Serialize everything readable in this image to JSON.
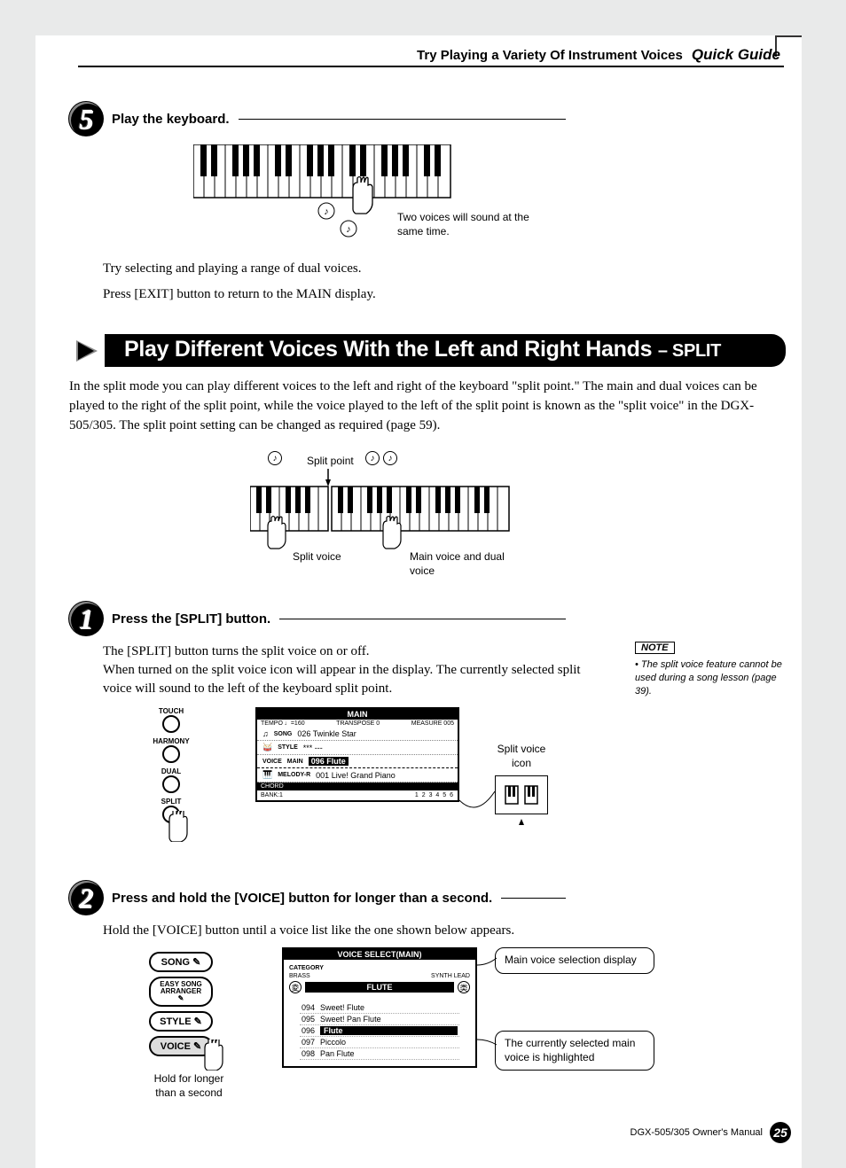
{
  "header": {
    "breadcrumb": "Try Playing a Variety Of Instrument Voices",
    "guide": "Quick Guide"
  },
  "step5": {
    "num": "5",
    "title": "Play the keyboard.",
    "callout": "Two voices will sound at the same time.",
    "body1": "Try selecting and playing a range of dual voices.",
    "body2": "Press [EXIT] button to return to the MAIN display."
  },
  "section": {
    "title_main": "Play Different Voices With the Left and Right Hands",
    "title_sub": "– SPLIT",
    "intro": "In the split mode you can play different voices to the left and right of the keyboard \"split point.\" The main and dual voices can be played to the right of the split point, while the voice played to the left of the split point is known as the \"split voice\" in the DGX-505/305. The split point setting can be changed as required (page 59)."
  },
  "split_diagram": {
    "split_point": "Split point",
    "split_voice": "Split voice",
    "main_voice": "Main voice and dual voice"
  },
  "step1": {
    "num": "1",
    "title": "Press the [SPLIT] button.",
    "body": "The [SPLIT] button turns the split voice on or off.\nWhen turned on the split voice icon will appear in the display. The currently selected split voice will sound to the left of the keyboard split point.",
    "note_label": "NOTE",
    "note_text": "• The split voice feature cannot be used during a song lesson (page 39).",
    "buttons": {
      "touch": "TOUCH",
      "harmony": "HARMONY",
      "dual": "DUAL",
      "split": "SPLIT"
    },
    "callout_icon": "Split voice icon",
    "lcd": {
      "title": "MAIN",
      "tempo": "TEMPO ♩=160",
      "transpose": "TRANSPOSE 0",
      "measure": "MEASURE 005",
      "song_label": "SONG",
      "song": "026 Twinkle Star",
      "style_label": "STYLE",
      "style": "*** ---",
      "voice_label": "VOICE",
      "main_label": "MAIN",
      "main": "096 Flute",
      "melody_label": "MELODY-R",
      "melody": "001 Live! Grand Piano",
      "chord": "CHORD",
      "bank": "BANK:1"
    }
  },
  "step2": {
    "num": "2",
    "title": "Press and hold the [VOICE] button for longer than a second.",
    "body": "Hold the [VOICE] button until a voice list like the one shown below appears.",
    "buttons": {
      "song": "SONG",
      "easy": "EASY SONG ARRANGER",
      "style": "STYLE",
      "voice": "VOICE"
    },
    "hold_hint": "Hold for longer than a second",
    "callout1": "Main voice selection display",
    "callout2": "The currently selected main voice is highlighted",
    "lcd": {
      "title": "VOICE SELECT(MAIN)",
      "category": "CATEGORY",
      "brass": "BRASS",
      "synth": "SYNTH LEAD",
      "flute_cat": "FLUTE",
      "items": [
        {
          "n": "094",
          "name": "Sweet! Flute"
        },
        {
          "n": "095",
          "name": "Sweet! Pan Flute"
        },
        {
          "n": "096",
          "name": "Flute",
          "selected": true
        },
        {
          "n": "097",
          "name": "Piccolo"
        },
        {
          "n": "098",
          "name": "Pan Flute"
        }
      ]
    }
  },
  "footer": {
    "text": "DGX-505/305  Owner's Manual",
    "page": "25"
  }
}
